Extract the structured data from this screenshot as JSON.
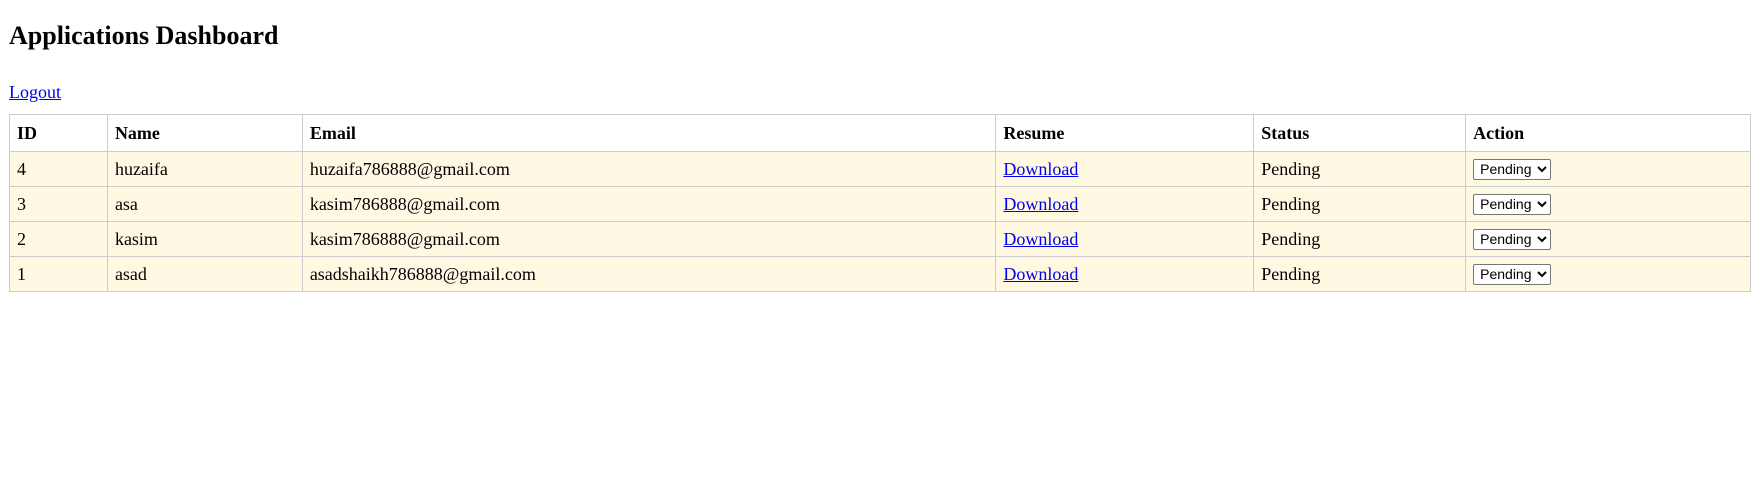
{
  "header": {
    "title": "Applications Dashboard",
    "logout_label": "Logout"
  },
  "table": {
    "columns": [
      "ID",
      "Name",
      "Email",
      "Resume",
      "Status",
      "Action"
    ],
    "rows": [
      {
        "id": "4",
        "name": "huzaifa",
        "email": "huzaifa786888@gmail.com",
        "resume": "Download",
        "status": "Pending",
        "action": "Pending"
      },
      {
        "id": "3",
        "name": "asa",
        "email": "kasim786888@gmail.com",
        "resume": "Download",
        "status": "Pending",
        "action": "Pending"
      },
      {
        "id": "2",
        "name": "kasim",
        "email": "kasim786888@gmail.com",
        "resume": "Download",
        "status": "Pending",
        "action": "Pending"
      },
      {
        "id": "1",
        "name": "asad",
        "email": "asadshaikh786888@gmail.com",
        "resume": "Download",
        "status": "Pending",
        "action": "Pending"
      }
    ]
  },
  "colors": {
    "row_background": "#fff9e3",
    "link": "#0000ee",
    "border": "#cccccc"
  }
}
